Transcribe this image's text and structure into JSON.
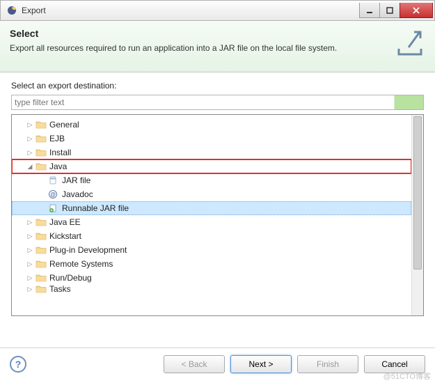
{
  "window": {
    "title": "Export"
  },
  "banner": {
    "title": "Select",
    "description": "Export all resources required to run an application into a JAR file on the local file system."
  },
  "body": {
    "label": "Select an export destination:",
    "filter_placeholder": "type filter text"
  },
  "tree": {
    "items": [
      {
        "label": "General",
        "level": 1,
        "icon": "folder",
        "expandable": true,
        "expanded": false
      },
      {
        "label": "EJB",
        "level": 1,
        "icon": "folder",
        "expandable": true,
        "expanded": false
      },
      {
        "label": "Install",
        "level": 1,
        "icon": "folder",
        "expandable": true,
        "expanded": false
      },
      {
        "label": "Java",
        "level": 1,
        "icon": "folder",
        "expandable": true,
        "expanded": true,
        "highlight": true
      },
      {
        "label": "JAR file",
        "level": 2,
        "icon": "jar",
        "expandable": false
      },
      {
        "label": "Javadoc",
        "level": 2,
        "icon": "javadoc",
        "expandable": false
      },
      {
        "label": "Runnable JAR file",
        "level": 2,
        "icon": "jar-run",
        "expandable": false,
        "selected": true,
        "highlight": true
      },
      {
        "label": "Java EE",
        "level": 1,
        "icon": "folder",
        "expandable": true,
        "expanded": false
      },
      {
        "label": "Kickstart",
        "level": 1,
        "icon": "folder",
        "expandable": true,
        "expanded": false
      },
      {
        "label": "Plug-in Development",
        "level": 1,
        "icon": "folder",
        "expandable": true,
        "expanded": false
      },
      {
        "label": "Remote Systems",
        "level": 1,
        "icon": "folder",
        "expandable": true,
        "expanded": false
      },
      {
        "label": "Run/Debug",
        "level": 1,
        "icon": "folder",
        "expandable": true,
        "expanded": false
      },
      {
        "label": "Tasks",
        "level": 1,
        "icon": "folder",
        "expandable": true,
        "expanded": false,
        "truncated": true
      }
    ]
  },
  "footer": {
    "help": "?",
    "back": "< Back",
    "next": "Next >",
    "finish": "Finish",
    "cancel": "Cancel"
  },
  "watermark": "@51CTO博客"
}
